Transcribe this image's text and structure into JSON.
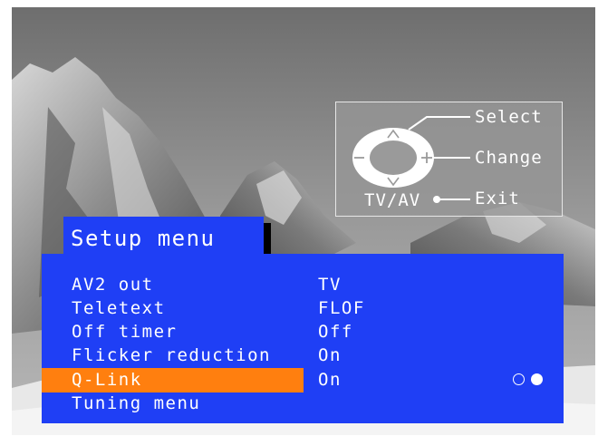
{
  "help": {
    "select_label": "Select",
    "change_label": "Change",
    "exit_label": "Exit",
    "tvav_label": "TV/AV"
  },
  "menu": {
    "title": "Setup menu",
    "items": [
      {
        "label": "AV2 out",
        "value": "TV",
        "selected": false
      },
      {
        "label": "Teletext",
        "value": "FLOF",
        "selected": false
      },
      {
        "label": "Off timer",
        "value": "Off",
        "selected": false
      },
      {
        "label": "Flicker reduction",
        "value": "On",
        "selected": false
      },
      {
        "label": "Q-Link",
        "value": "On",
        "selected": true
      },
      {
        "label": "Tuning menu",
        "value": "",
        "selected": false
      }
    ]
  },
  "colors": {
    "menu_blue": "#1f3ff5",
    "highlight_orange": "#ff7f0f",
    "text_white": "#ffffff"
  },
  "icons": {
    "remote": "oval-navigation-ring",
    "up": "caret-up",
    "down": "caret-down",
    "left": "minus",
    "right": "plus",
    "exit": "filled-dot",
    "page_indicator": [
      "hollow-circle",
      "filled-circle"
    ]
  }
}
